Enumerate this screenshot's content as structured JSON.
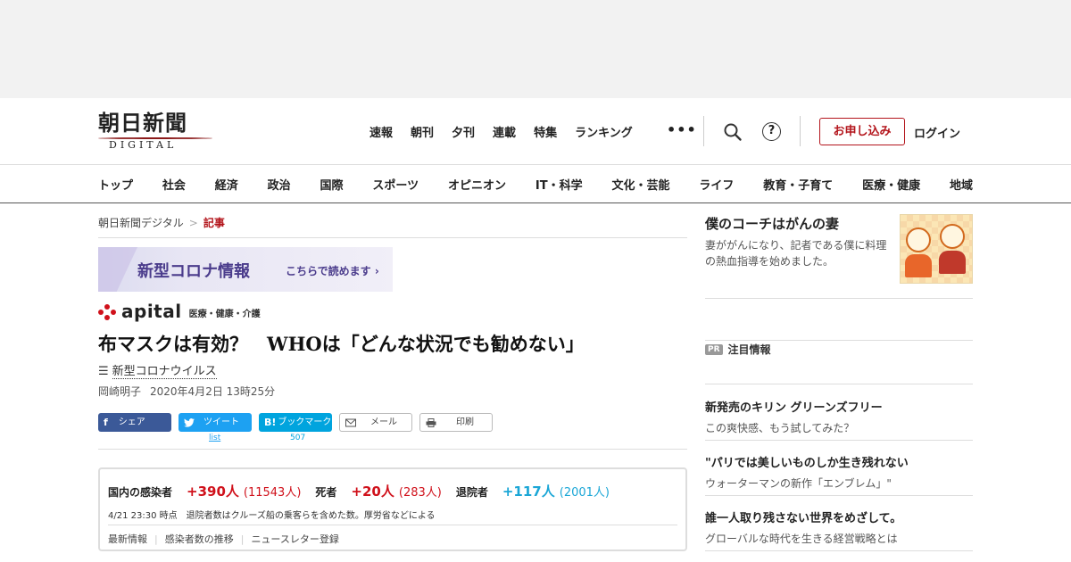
{
  "header": {
    "logo_jp": "朝日新聞",
    "logo_en": "DIGITAL",
    "topnav": [
      "速報",
      "朝刊",
      "夕刊",
      "連載",
      "特集",
      "ランキング"
    ],
    "more": "•••",
    "help_icon_text": "?",
    "apply_label": "お申し込み",
    "login_label": "ログイン"
  },
  "categories": [
    "トップ",
    "社会",
    "経済",
    "政治",
    "国際",
    "スポーツ",
    "オピニオン",
    "IT・科学",
    "文化・芸能",
    "ライフ",
    "教育・子育て",
    "医療・健康",
    "地域"
  ],
  "breadcrumb": {
    "home": "朝日新聞デジタル",
    "sep": ">",
    "current": "記事"
  },
  "banner": {
    "main": "新型コロナ情報",
    "sub": "こちらで読めます ›"
  },
  "apital": {
    "word": "apital",
    "tag": "医療・健康・介護"
  },
  "article": {
    "title": "布マスクは有効？　WHOは「どんな状況でも勧めない」",
    "topic_icon": "☰",
    "topic": "新型コロナウイルス",
    "author": "岡崎明子",
    "date": "2020年4月2日 13時25分"
  },
  "share": {
    "facebook": "シェア",
    "twitter": "ツイート",
    "hatena": "ブックマーク",
    "hatena_icon": "B!",
    "mail": "メール",
    "print": "印刷",
    "twitter_count": "list",
    "hatena_count": "507"
  },
  "stats": {
    "infected_label": "国内の感染者",
    "infected_new": "+390人",
    "infected_total": "(11543人)",
    "deaths_label": "死者",
    "deaths_new": "+20人",
    "deaths_total": "(283人)",
    "recovered_label": "退院者",
    "recovered_new": "+117人",
    "recovered_total": "(2001人)",
    "note": "4/21 23:30 時点　退院者数はクルーズ船の乗客らを含めた数。厚労省などによる",
    "links": [
      "最新情報",
      "感染者数の推移",
      "ニュースレター登録"
    ]
  },
  "sidebar": {
    "promo_title": "僕のコーチはがんの妻",
    "promo_desc": "妻ががんになり、記者である僕に料理の熱血指導を始めました。",
    "pr_badge": "PR",
    "pr_label": "注目情報",
    "items": [
      {
        "title": "新発売のキリン グリーンズフリー",
        "desc": "この爽快感、もう試してみた？"
      },
      {
        "title": "\"パリでは美しいものしか生き残れない",
        "desc": "ウォーターマンの新作「エンブレム」\""
      },
      {
        "title": "誰一人取り残さない世界をめざして。",
        "desc": "グローバルな時代を生きる経営戦略とは"
      }
    ]
  },
  "colors": {
    "brand_red": "#b3141b",
    "stat_red": "#d0111b",
    "stat_blue": "#1aa6d6",
    "banner_purple": "#4b3c8c"
  }
}
